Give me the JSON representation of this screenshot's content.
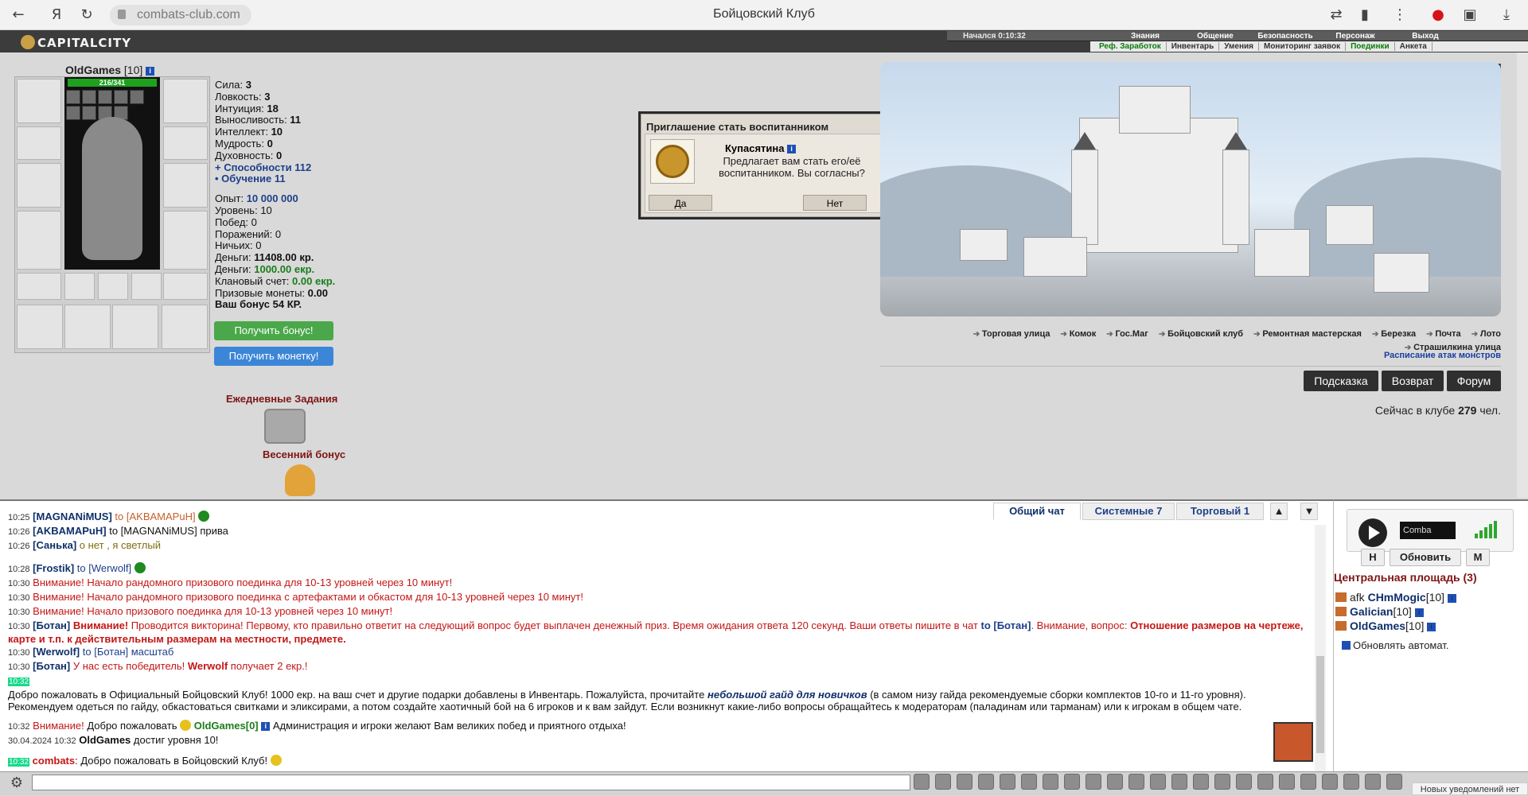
{
  "browser": {
    "url": "combats-club.com",
    "page_title": "Бойцовский Клуб"
  },
  "logo": "CAPITALCITY",
  "menu": {
    "started": "Начался  0:10:32",
    "top": [
      "Знания",
      "Общение",
      "Безопасность",
      "Персонаж",
      "Выход"
    ],
    "sub": [
      "Реф. Заработок",
      "Инвентарь",
      "Умения",
      "Мониторинг заявок",
      "Поединки",
      "Анкета"
    ]
  },
  "character": {
    "name": "OldGames",
    "level": "[10]",
    "hp": "216/341",
    "stats": [
      {
        "label": "Сила:",
        "value": "3"
      },
      {
        "label": "Ловкость:",
        "value": "3"
      },
      {
        "label": "Интуиция:",
        "value": "18"
      },
      {
        "label": "Выносливость:",
        "value": "11"
      },
      {
        "label": "Интеллект:",
        "value": "10"
      },
      {
        "label": "Мудрость:",
        "value": "0"
      },
      {
        "label": "Духовность:",
        "value": "0"
      }
    ],
    "abilities": "+ Способности  112",
    "training": "• Обучение  11",
    "exp_label": "Опыт:",
    "exp": "10 000 000",
    "level_label": "Уровень:",
    "level_val": "10",
    "wins_label": "Побед:",
    "wins": "0",
    "losses_label": "Поражений:",
    "losses": "0",
    "draws_label": "Ничьих:",
    "draws": "0",
    "money_label": "Деньги:",
    "money": "11408.00 кр.",
    "money2_label": "Деньги:",
    "money2": "1000.00 екр.",
    "clan_label": "Клановый счет:",
    "clan": "0.00 екр.",
    "prize_label": "Призовые монеты:",
    "prize": "0.00",
    "bonus": "Ваш бонус 54 КР.",
    "get_bonus": "Получить бонус!",
    "get_coin": "Получить монетку!",
    "daily": "Ежедневные Задания",
    "spring": "Весенний бонус"
  },
  "dialog": {
    "title": "Приглашение стать воспитанником",
    "name": "Купасятина",
    "text": "Предлагает вам стать его/её воспитанником. Вы согласны?",
    "yes": "Да",
    "no": "Нет"
  },
  "locations": [
    "Торговая улица",
    "Комок",
    "Гос.Маг",
    "Бойцовский клуб",
    "Ремонтная мастерская",
    "Березка",
    "Почта",
    "Лото",
    "Страшилкина улица"
  ],
  "schedule": "Расписание атак монстров",
  "buttons": {
    "hint": "Подсказка",
    "back": "Возврат",
    "forum": "Форум"
  },
  "online": {
    "text": "Сейчас в клубе",
    "count": "279",
    "unit": "чел."
  },
  "chat_tabs": [
    "Общий чат",
    "Системные 7",
    "Торговый 1",
    "▲",
    "▼"
  ],
  "chat": [
    {
      "t": "10:25",
      "a": "[MAGNANiMUS]",
      "b": " to [AKBAMAPuH]",
      "c": ""
    },
    {
      "t": "10:26",
      "a": "[AKBAMAPuH]",
      "b": " to [MAGNANiMUS] ",
      "c": "прива"
    },
    {
      "t": "10:26",
      "a": "[Санька]",
      "b": " о нет , я светлый",
      "c": ""
    },
    {
      "t": "10:28",
      "a": "[Frostik]",
      "b": " to [Werwolf]",
      "c": ""
    },
    {
      "t": "10:30",
      "r": "Внимание! Начало рандомного призового поединка для 10-13 уровней через 10 минут!"
    },
    {
      "t": "10:30",
      "r": "Внимание! Начало рандомного призового поединка с артефактами и обкастом для 10-13 уровней через 10 минут!"
    },
    {
      "t": "10:30",
      "r": "Внимание! Начало призового поединка для 10-13 уровней через 10 минут!"
    }
  ],
  "chat_bot": {
    "t": "10:30",
    "who": "[Ботан]",
    "att": "Внимание!",
    "text": " Проводится викторина! Первому, кто правильно ответит на следующий вопрос будет выплачен денежный приз. Время ожидания ответа 120 секунд. Ваши ответы пишите в чат ",
    "to": "to [Ботан]",
    "q": ". Внимание, вопрос: ",
    "bold": "Отношение размеров на чертеже, карте и т.п. к действительным размерам на местности, предмете."
  },
  "chat_w": {
    "t": "10:30",
    "a": "[Werwolf]",
    "b": " to [Ботан] масштаб"
  },
  "chat_win": {
    "t": "10:30",
    "a": "[Ботан]",
    "r": " У нас есть победитель! ",
    "w": "Werwolf",
    "r2": " получает 2 екр.!"
  },
  "chat_hl": "10:32",
  "welcome": {
    "a": "Добро пожаловать в Официальный Бойцовский Клуб! 1000 екр. на ваш счет и другие подарки добавлены в Инвентарь. Пожалуйста, прочитайте ",
    "link": "небольшой гайд для новичков",
    "b": " (в самом низу гайда рекомендуемые сборки комплектов 10-го и 11-го уровня). Рекомендуем одеться по гайду, обкастоваться свитками и эликсирами, а потом создайте хаотичный бой на 6 игроков и к вам зайдут. Если возникнут какие-либо вопросы обращайтесь к модераторам (паладинам или тарманам) или к игрокам в общем чате."
  },
  "chat_welcome2": {
    "t": "10:32",
    "att": "Внимание!",
    "text": " Добро пожаловать ",
    "nick": "OldGames[0]",
    "rest": " Администрация и игроки желают Вам великих побед и приятного отдыха!"
  },
  "chat_level": {
    "t": "30.04.2024 10:32",
    "nick": "OldGames",
    "text": " достиг уровня 10!"
  },
  "chat_last": {
    "t": "10:32",
    "nick": "combats",
    "text": ": Добро пожаловать в Бойцовский Клуб!"
  },
  "radio": {
    "station": "Comba"
  },
  "right_buttons": {
    "h": "Н",
    "refresh": "Обновить",
    "m": "М"
  },
  "square": "Центральная площадь (3)",
  "users": [
    {
      "prefix": "afk ",
      "nick": "CHmMogic",
      "lvl": "[10]"
    },
    {
      "prefix": "",
      "nick": "Galician",
      "lvl": "[10]"
    },
    {
      "prefix": "",
      "nick": "OldGames",
      "lvl": "[10]"
    }
  ],
  "auto_update": "Обновлять автомат.",
  "notification": "Новых уведомлений нет"
}
